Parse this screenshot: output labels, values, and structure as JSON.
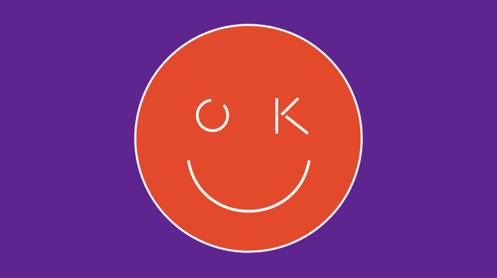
{
  "logo": {
    "name": "OK smiley face",
    "eyes_text": "O K",
    "left_eye": "O",
    "right_eye": "K"
  },
  "colors": {
    "background": "#5e2590",
    "face_fill": "#e24a2b",
    "face_outline": "#ffffff",
    "strokes": "#ffffff"
  }
}
